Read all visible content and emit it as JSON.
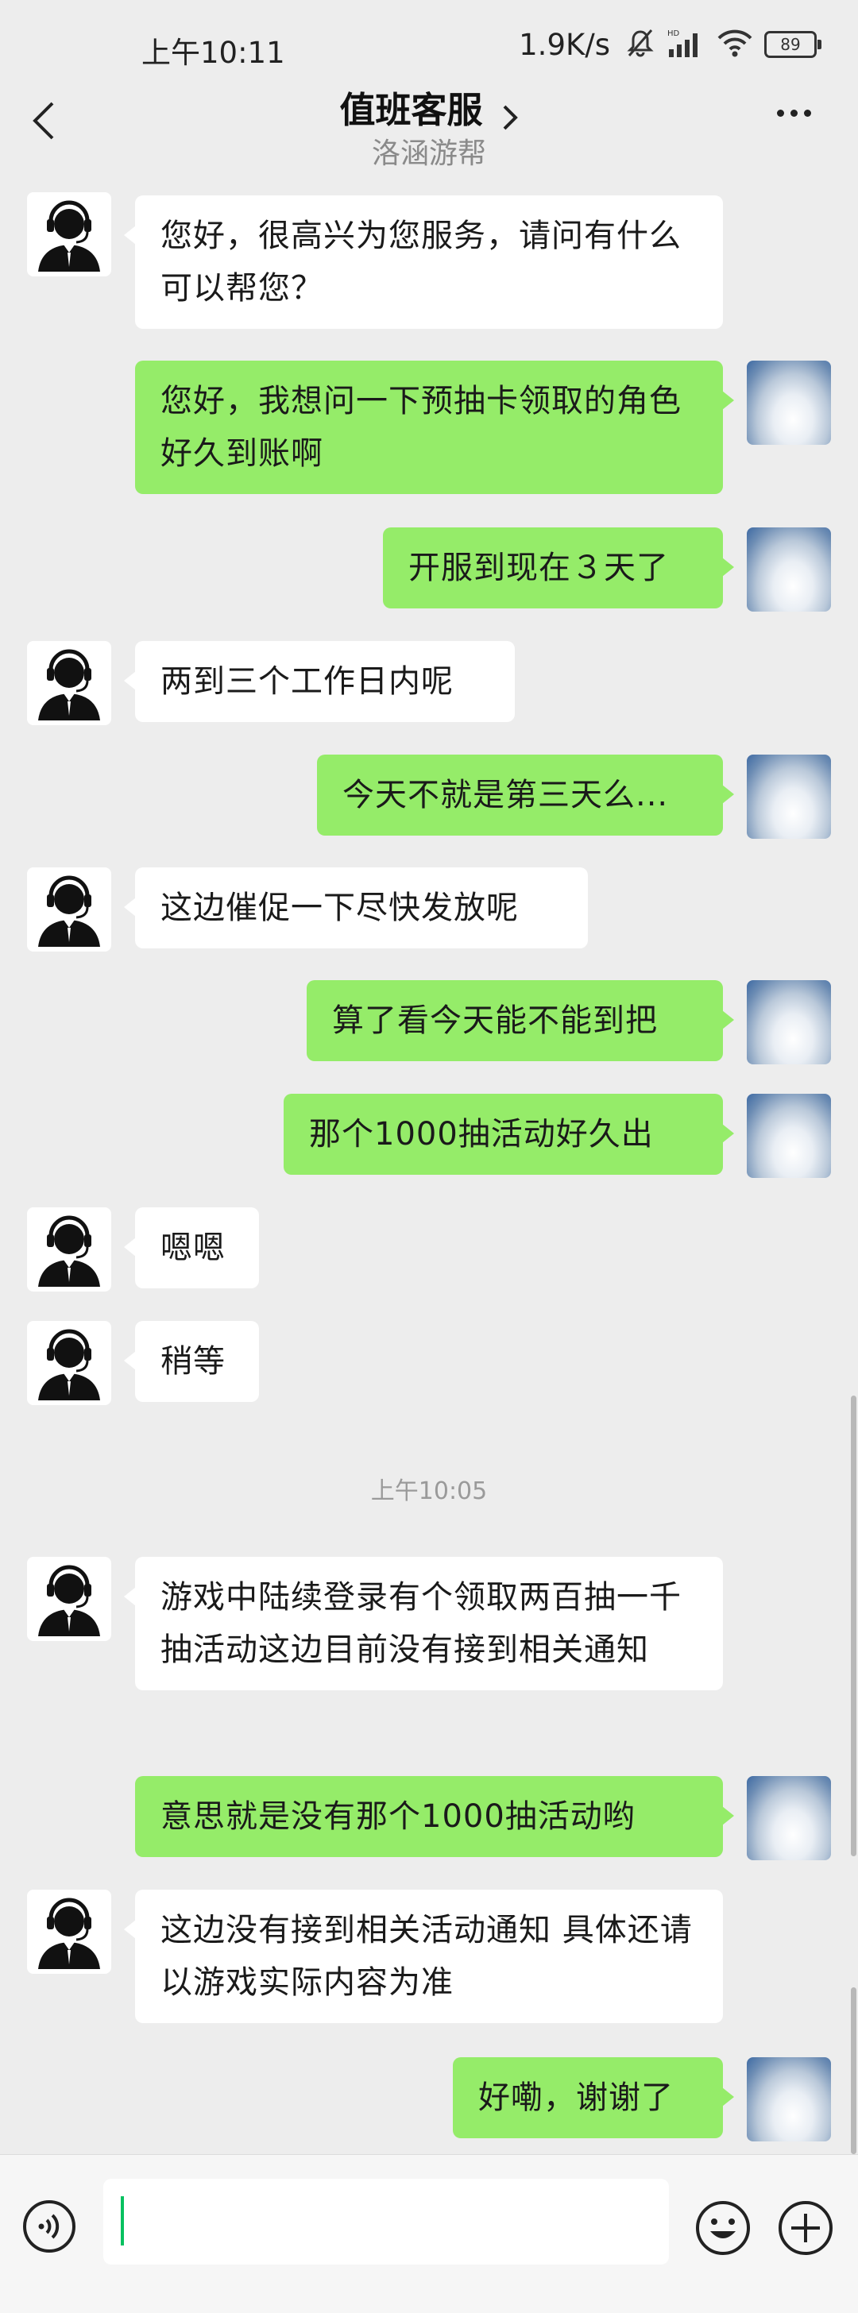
{
  "status_bar": {
    "time": "上午10:11",
    "speed": "1.9K/s",
    "battery": "89",
    "icons": [
      "mute-icon",
      "hd-signal-icon",
      "wifi-icon",
      "battery-icon"
    ]
  },
  "header": {
    "title": "值班客服",
    "subtitle": "洛涵游帮",
    "back_icon": "chevron-left-icon",
    "title_icon": "chevron-right-icon",
    "more_icon": "more-icon"
  },
  "messages": [
    {
      "side": "in",
      "text": "您好，很高兴为您服务，请问有什么可以帮您？"
    },
    {
      "side": "out",
      "text": "您好，我想问一下预抽卡领取的角色好久到账啊"
    },
    {
      "side": "out",
      "text": "开服到现在３天了"
    },
    {
      "side": "in",
      "text": "两到三个工作日内呢"
    },
    {
      "side": "out",
      "text": "今天不就是第三天么..."
    },
    {
      "side": "in",
      "text": "这边催促一下尽快发放呢"
    },
    {
      "side": "out",
      "text": "算了看今天能不能到把"
    },
    {
      "side": "out",
      "text": "那个1000抽活动好久出"
    },
    {
      "side": "in",
      "text": "嗯嗯"
    },
    {
      "side": "in",
      "text": "稍等"
    },
    {
      "side": "time",
      "text": "上午10:05"
    },
    {
      "side": "in",
      "text": "游戏中陆续登录有个领取两百抽一千抽活动这边目前没有接到相关通知"
    },
    {
      "side": "out",
      "text": "意思就是没有那个1000抽活动哟"
    },
    {
      "side": "in",
      "text": "这边没有接到相关活动通知  具体还请以游戏实际内容为准"
    },
    {
      "side": "out",
      "text": "好嘞，谢谢了"
    }
  ],
  "input_bar": {
    "voice_icon": "voice-icon",
    "input_value": "",
    "emoji_icon": "emoji-icon",
    "plus_icon": "plus-icon"
  },
  "colors": {
    "outgoing_bubble": "#95ec69",
    "incoming_bubble": "#ffffff",
    "background": "#ededed",
    "accent": "#07c160"
  }
}
